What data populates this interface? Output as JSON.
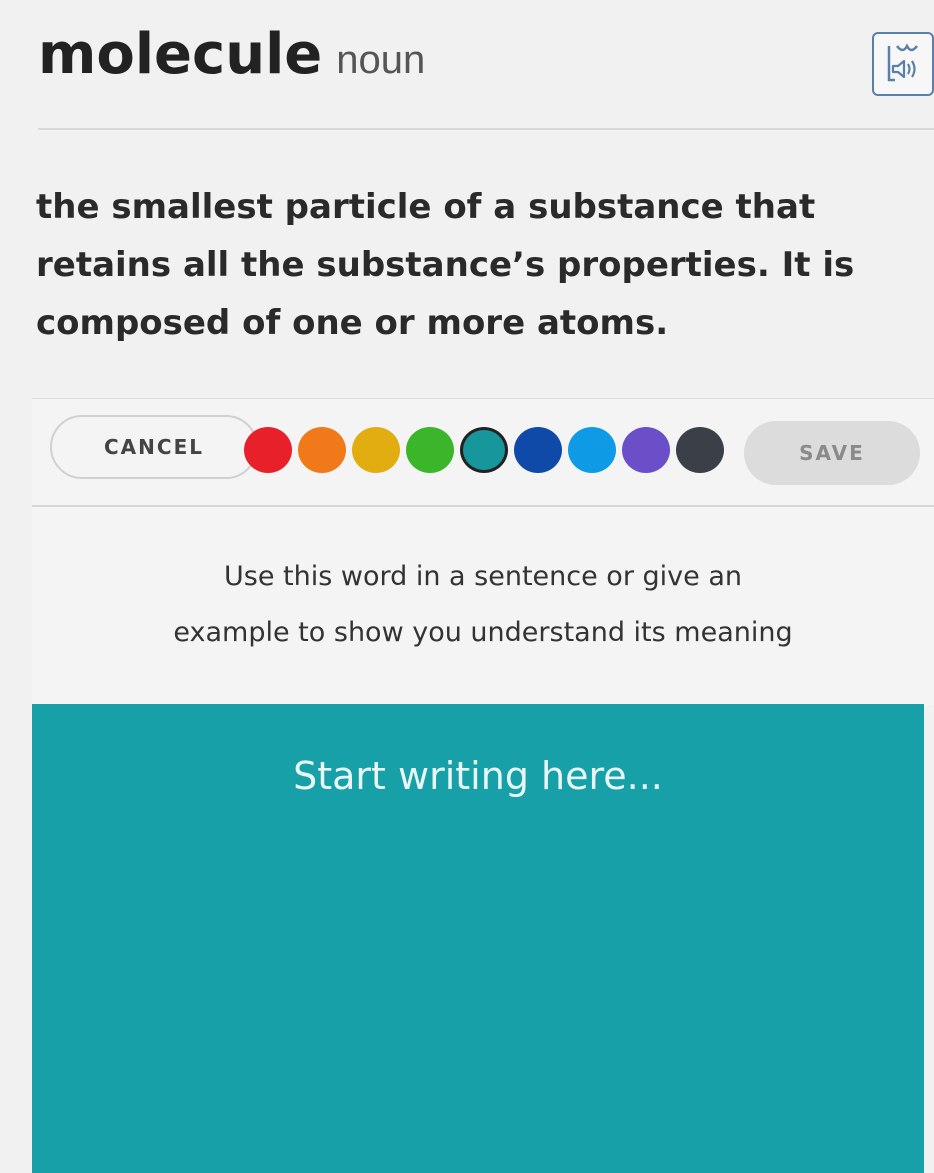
{
  "entry": {
    "word": "molecule",
    "part_of_speech": "noun",
    "definition": "the smallest particle of a substance that retains all the substance’s properties. It is composed of one or more atoms."
  },
  "audio_button": {
    "icon": "speaker-icon"
  },
  "toolbar": {
    "cancel_label": "CANCEL",
    "save_label": "SAVE",
    "colors": [
      {
        "name": "red",
        "hex": "#e8202a"
      },
      {
        "name": "orange",
        "hex": "#f07a1a"
      },
      {
        "name": "yellow",
        "hex": "#e2ad10"
      },
      {
        "name": "green",
        "hex": "#3bb52a"
      },
      {
        "name": "teal",
        "hex": "#17969c",
        "selected": true
      },
      {
        "name": "dark-blue",
        "hex": "#0f4aa8"
      },
      {
        "name": "blue",
        "hex": "#0f9ae6"
      },
      {
        "name": "purple",
        "hex": "#6a4fc8"
      },
      {
        "name": "charcoal",
        "hex": "#3a3f48"
      }
    ]
  },
  "prompt": {
    "line1": "Use this word in a sentence or give an",
    "line2": "example to show you understand its meaning"
  },
  "editor": {
    "placeholder": "Start writing here...",
    "background": "#17a0a8"
  }
}
